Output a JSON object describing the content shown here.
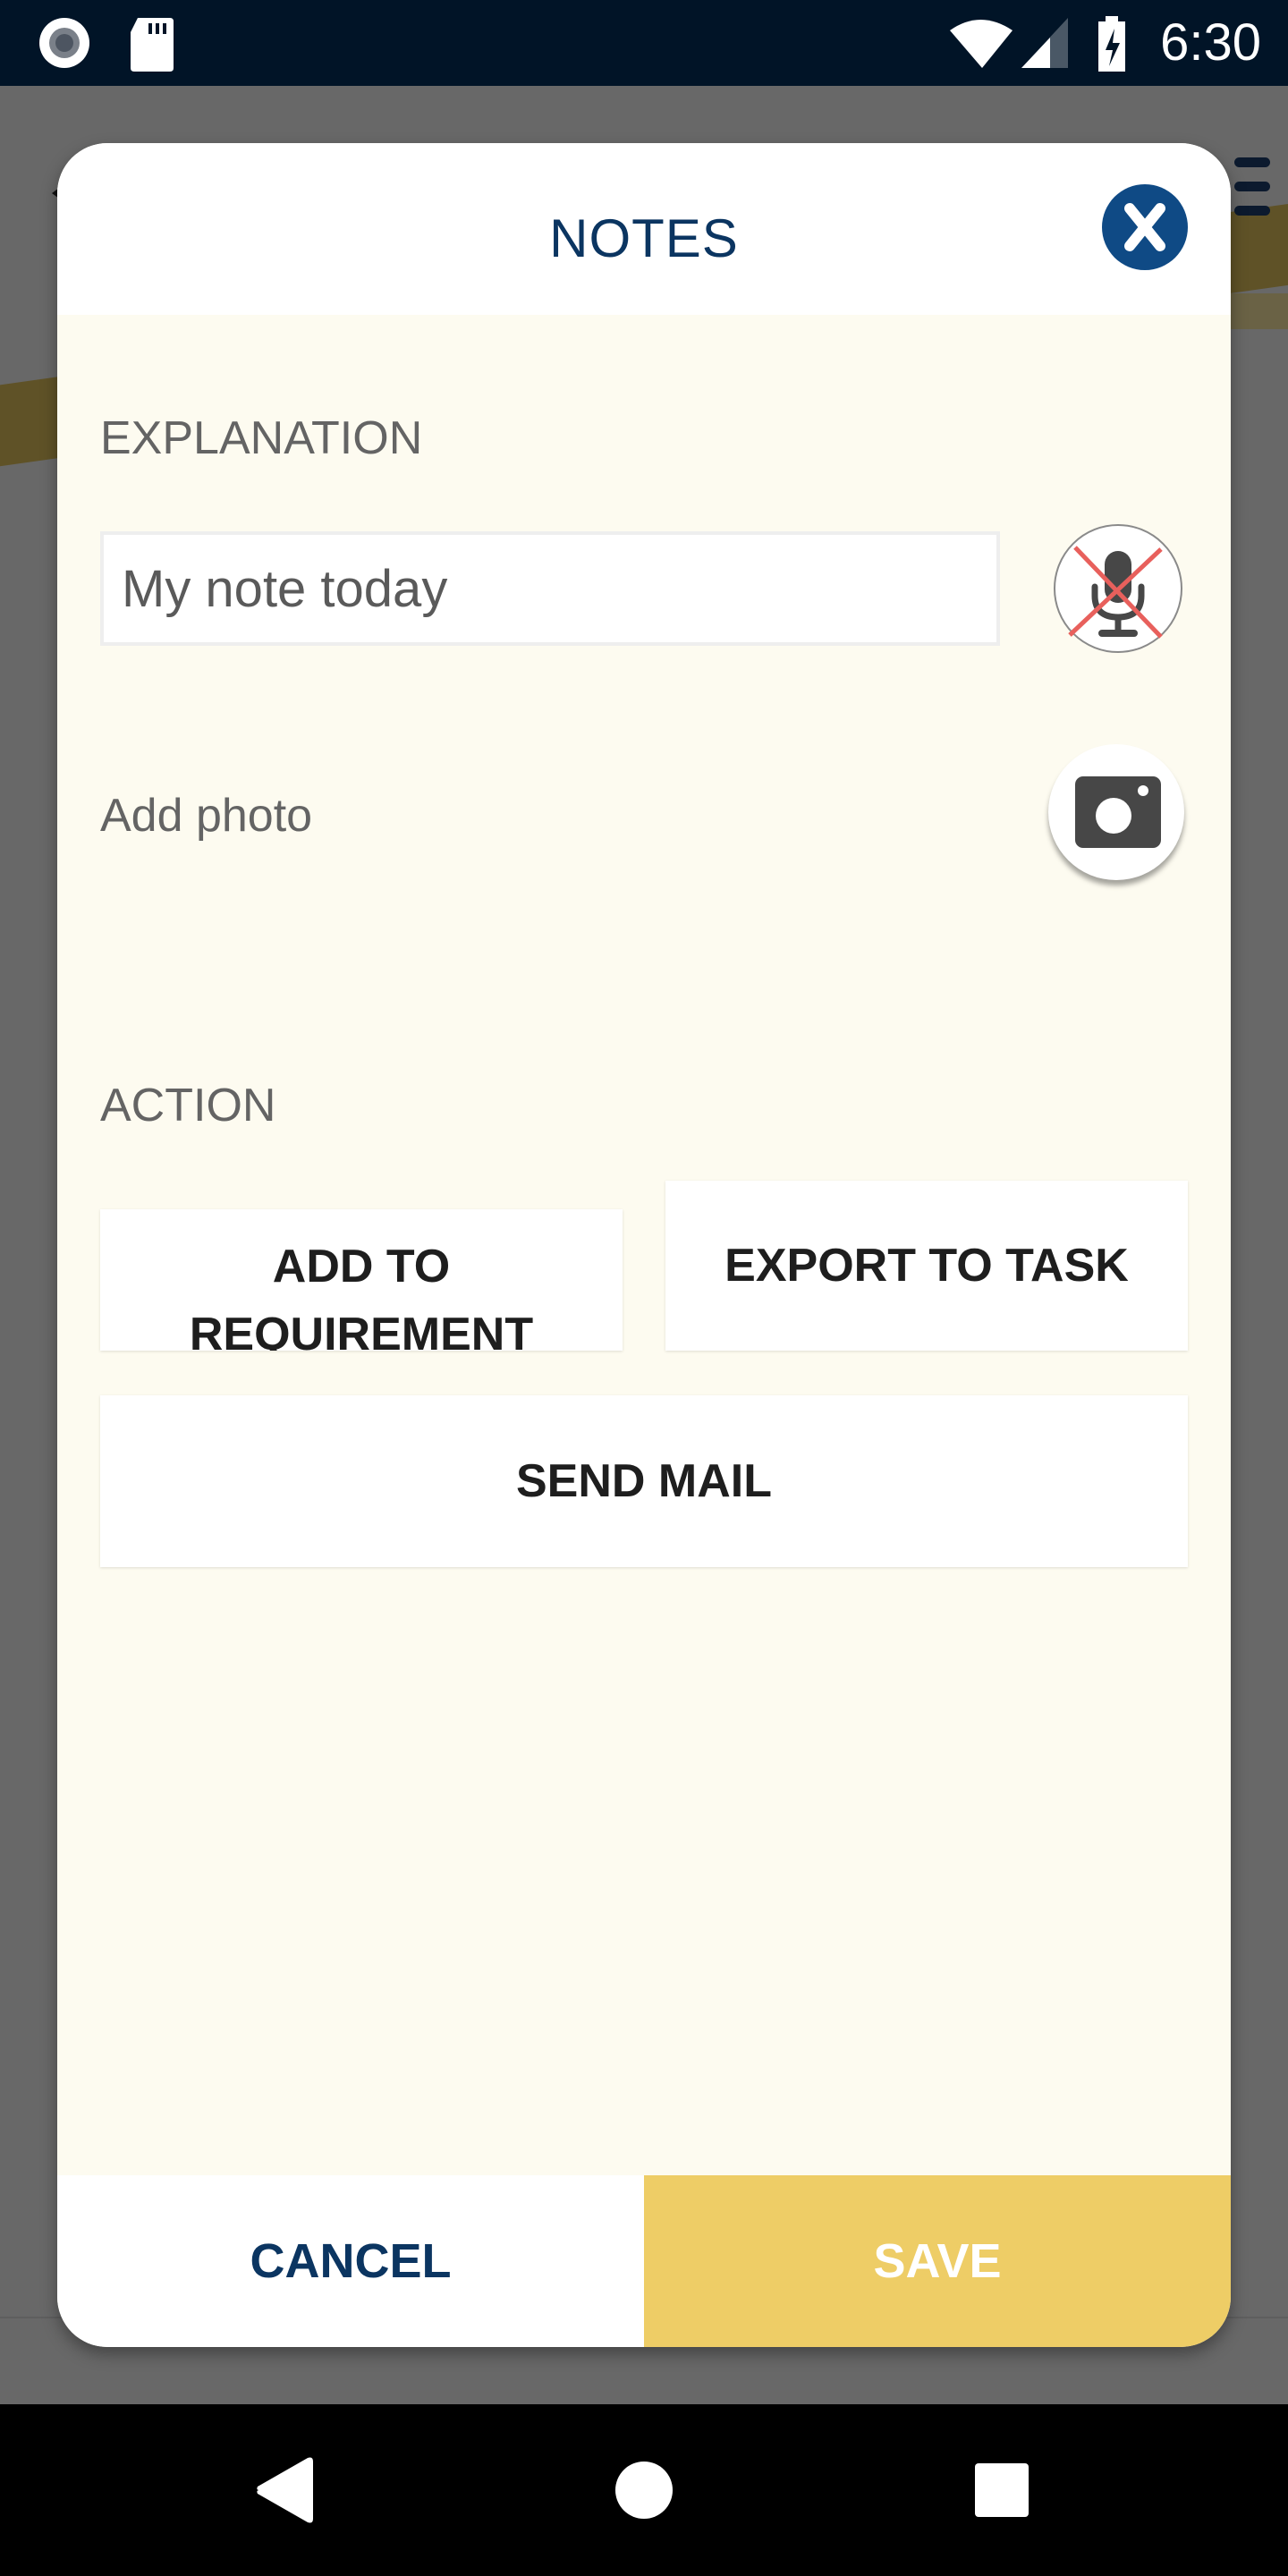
{
  "status_bar": {
    "time": "6:30",
    "left_icons": [
      "record-icon",
      "sd-card-icon"
    ],
    "right_icons": [
      "wifi-icon",
      "cell-signal-icon",
      "battery-charging-icon"
    ]
  },
  "modal": {
    "title": "NOTES",
    "close_icon": "close-icon",
    "explanation_label": "EXPLANATION",
    "note_input": {
      "value": "My note today",
      "placeholder": ""
    },
    "mic_icon": "microphone-off-icon",
    "add_photo_label": "Add photo",
    "camera_icon": "camera-icon",
    "action_label": "ACTION",
    "actions": {
      "add_to_requirement": "ADD TO\nREQUIREMENT",
      "add_to_requirement_line1": "ADD TO",
      "add_to_requirement_line2": "REQUIREMENT",
      "export_to_task": "EXPORT TO TASK",
      "send_mail": "SEND MAIL"
    },
    "footer": {
      "cancel": "CANCEL",
      "save": "SAVE"
    }
  },
  "colors": {
    "primary_navy": "#0b3561",
    "close_blue": "#0f4a85",
    "save_yellow": "#eecd66",
    "body_cream": "#fdfbf0",
    "mute_red": "#e8605c",
    "status_bar": "#011427"
  },
  "nav_bar": {
    "icons": [
      "back-icon",
      "home-icon",
      "recents-icon"
    ]
  }
}
